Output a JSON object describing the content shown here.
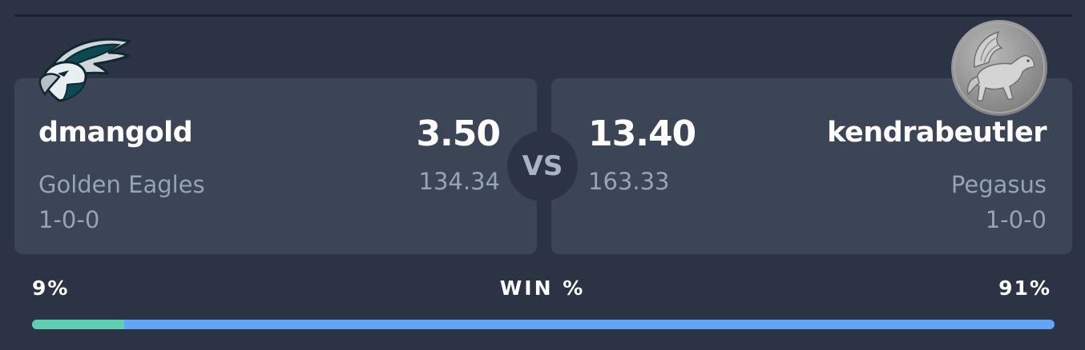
{
  "matchup": {
    "left": {
      "owner": "dmangold",
      "team": "Golden Eagles",
      "record": "1-0-0",
      "score": "3.50",
      "projected": "134.34",
      "logo": "eagle-logo-icon"
    },
    "right": {
      "owner": "kendrabeutler",
      "team": "Pegasus",
      "record": "1-0-0",
      "score": "13.40",
      "projected": "163.33",
      "logo": "pegasus-avatar-icon"
    },
    "vs_label": "VS"
  },
  "win_probability": {
    "title": "WIN %",
    "left_label": "9%",
    "right_label": "91%",
    "left_fraction": 0.09,
    "colors": {
      "left": "#5ecfb0",
      "right": "#62a4f5"
    }
  }
}
